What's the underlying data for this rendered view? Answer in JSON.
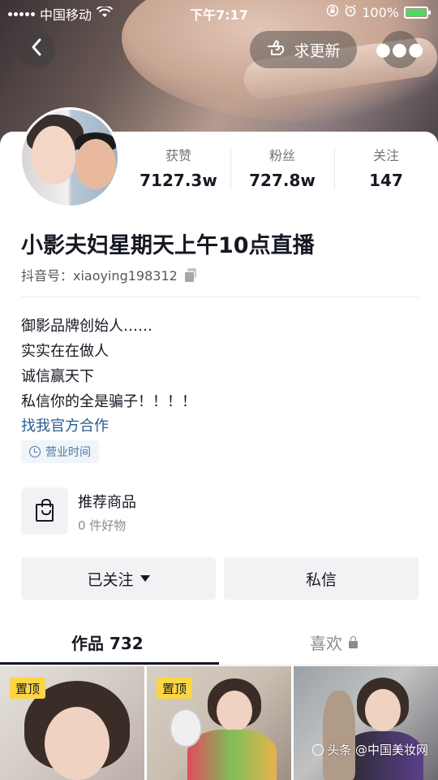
{
  "status_bar": {
    "carrier": "中国移动",
    "time": "下午7:17",
    "battery_percent": "100%",
    "battery_level": 1.0
  },
  "top_bar": {
    "update_label": "求更新"
  },
  "profile": {
    "stats": [
      {
        "label": "获赞",
        "value": "7127.3w"
      },
      {
        "label": "粉丝",
        "value": "727.8w"
      },
      {
        "label": "关注",
        "value": "147"
      }
    ],
    "name": "小影夫妇星期天上午10点直播",
    "douyin_id": "抖音号：xiaoying198312",
    "bio_lines": [
      "御影品牌创始人……",
      "实实在在做人",
      "诚信赢天下",
      "私信你的全是骗子！！！！"
    ],
    "cooperation_link": "找我官方合作",
    "hours_label": "营业时间"
  },
  "shop": {
    "title": "推荐商品",
    "subtitle": "0 件好物"
  },
  "actions": {
    "follow_label": "已关注",
    "message_label": "私信"
  },
  "tabs": {
    "works_label": "作品 732",
    "likes_label": "喜欢"
  },
  "grid": {
    "pinned_label": "置顶"
  },
  "watermark": {
    "text": "头条 @中国美妆网"
  },
  "colors": {
    "accent_link": "#2a5b8c",
    "pin_badge": "#fbd542",
    "battery_fill": "#4cd964"
  }
}
